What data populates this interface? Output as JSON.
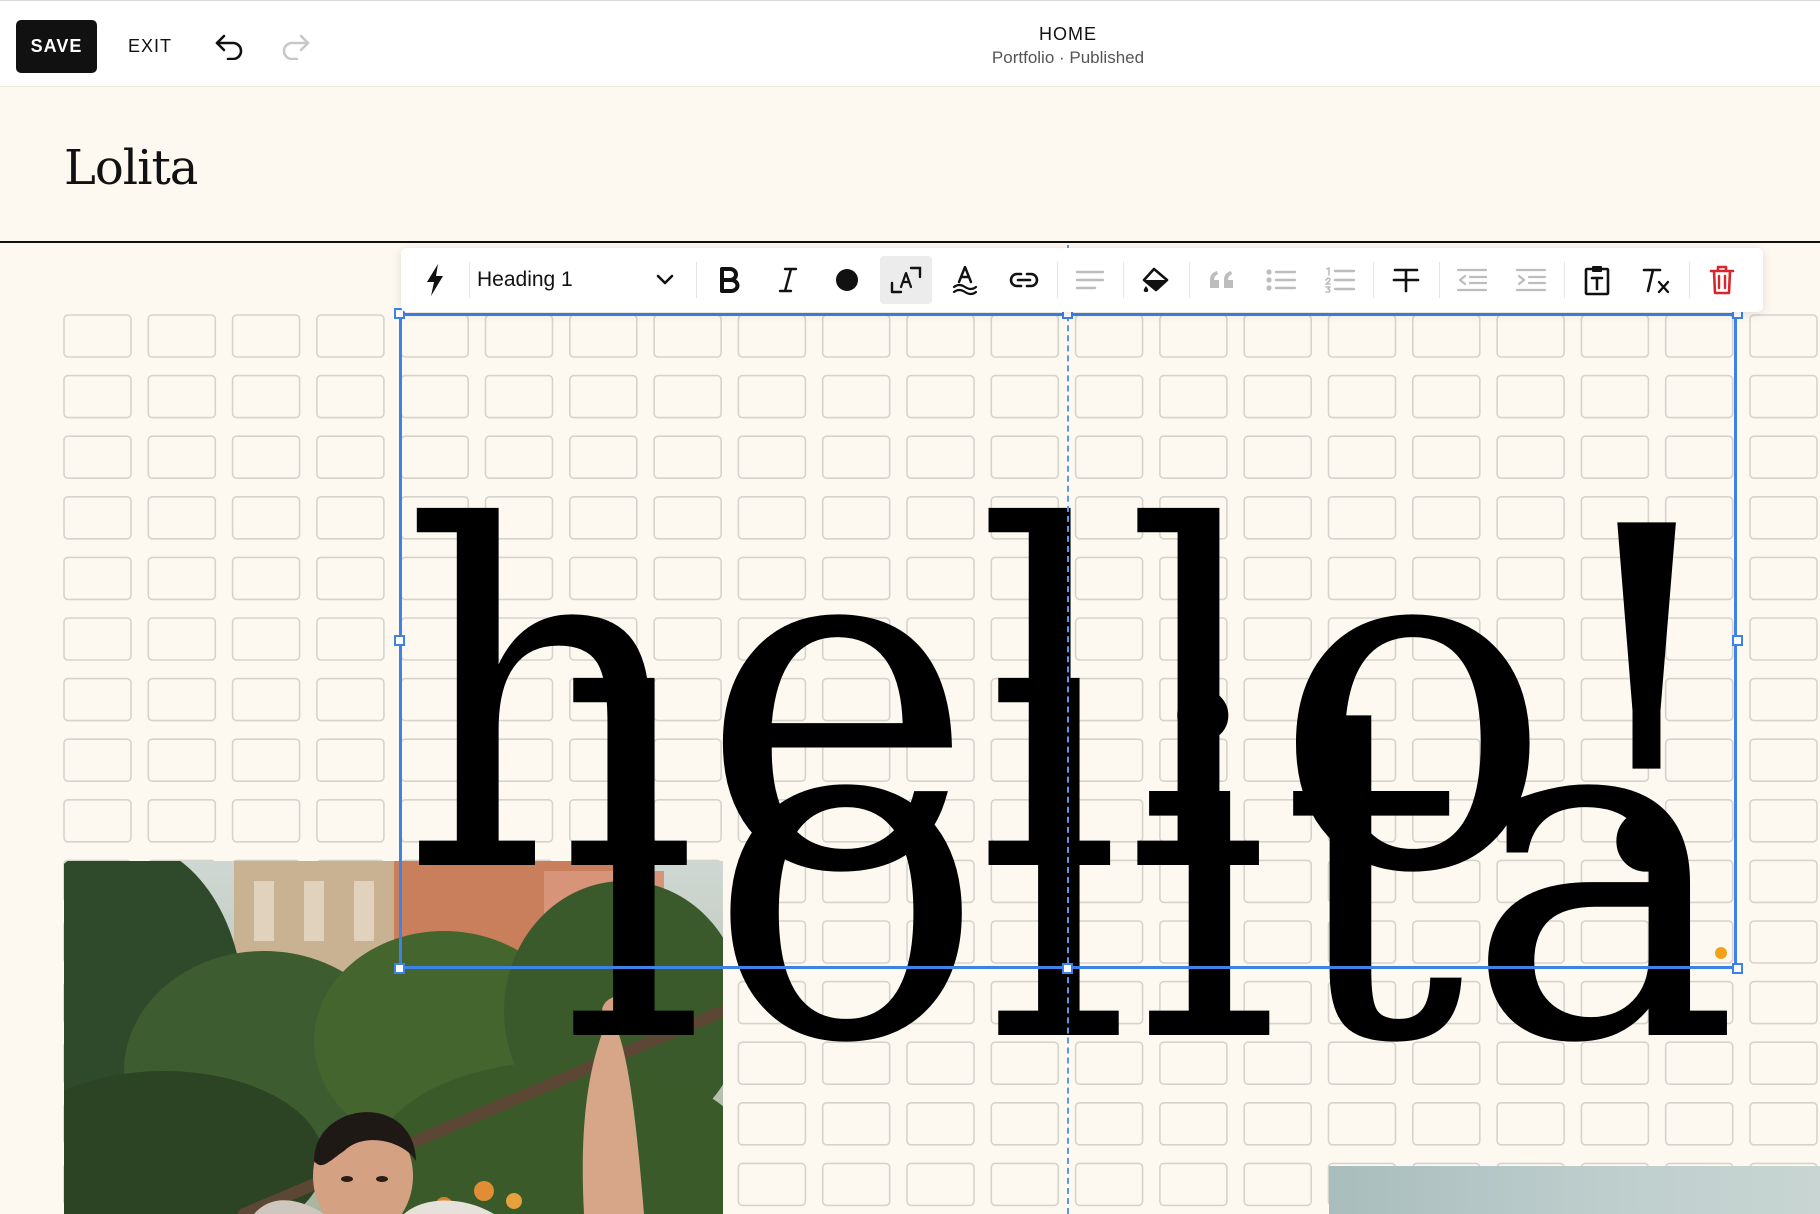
{
  "editor": {
    "save_label": "SAVE",
    "exit_label": "EXIT",
    "page_title": "HOME",
    "page_subtitle": "Portfolio · Published"
  },
  "site": {
    "logo_text": "Lolita"
  },
  "toolbar": {
    "text_style": "Heading 1",
    "icons": [
      "lightning-icon",
      "bold-icon",
      "italic-icon",
      "text-color-icon",
      "text-size-icon",
      "strikethrough-style-icon",
      "link-icon",
      "align-left-icon",
      "fill-color-icon",
      "quote-icon",
      "bullet-list-icon",
      "numbered-list-icon",
      "strikethrough-icon",
      "outdent-icon",
      "indent-icon",
      "paste-text-icon",
      "clear-formatting-icon",
      "delete-icon"
    ]
  },
  "headline": {
    "line1": "hello!",
    "line2": "lolita"
  },
  "colors": {
    "background": "#fdf9f1",
    "selection": "#3d82e6",
    "delete": "#d9262c",
    "anchor": "#f4a21a"
  }
}
